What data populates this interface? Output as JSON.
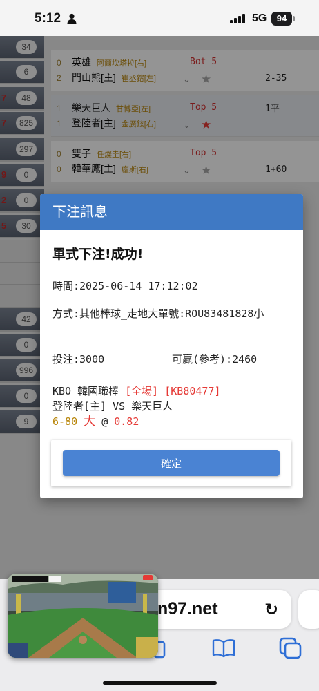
{
  "status_bar": {
    "time": "5:12",
    "network": "5G",
    "battery": "94"
  },
  "left_column": {
    "items": [
      {
        "count": "34",
        "mark": ""
      },
      {
        "count": "6",
        "mark": ""
      },
      {
        "count": "48",
        "mark": "7"
      },
      {
        "count": "825",
        "mark": "7"
      },
      {
        "count": "297",
        "mark": ""
      },
      {
        "count": "0",
        "mark": "9"
      },
      {
        "count": "0",
        "mark": "2"
      },
      {
        "count": "30",
        "mark": "5"
      }
    ],
    "lower_items": [
      {
        "count": "42"
      },
      {
        "count": "0"
      },
      {
        "count": "996"
      },
      {
        "count": "0"
      },
      {
        "count": "9"
      }
    ]
  },
  "games": [
    {
      "away": {
        "score": "0",
        "team": "英雄",
        "pitcher": "阿爾坎塔拉[右]"
      },
      "home": {
        "score": "2",
        "team": "門山熊[主]",
        "pitcher": "崔丞鎔[左]"
      },
      "inning": "Bot 5",
      "line": "2-35",
      "line_row": "home",
      "starred": false
    },
    {
      "away": {
        "score": "1",
        "team": "樂天巨人",
        "pitcher": "甘博亞[左]"
      },
      "home": {
        "score": "1",
        "team": "登陸者[主]",
        "pitcher": "金廣鉉[右]"
      },
      "inning": "Top 5",
      "line": "1平",
      "line_row": "away",
      "starred": true
    },
    {
      "away": {
        "score": "0",
        "team": "雙子",
        "pitcher": "任燦圭[右]"
      },
      "home": {
        "score": "0",
        "team": "韓華鷹[主]",
        "pitcher": "龐斯[右]"
      },
      "inning": "Top 5",
      "line": "1+60",
      "line_row": "home",
      "starred": false
    }
  ],
  "modal": {
    "header": "下注訊息",
    "title": "單式下注!成功!",
    "time_label": "時間:",
    "time_value": "2025-06-14 17:12:02",
    "method_label": "方式:",
    "method_value": "其他棒球_走地大單號:ROU83481828小",
    "stake_label": "投注:",
    "stake_value": "3000",
    "win_label": "可贏(參考):",
    "win_value": "2460",
    "league": "KBO 韓國職棒",
    "period": "[全場]",
    "code": "[KB80477]",
    "matchup": "登陸者[主] VS 樂天巨人",
    "bet_line": "6-80",
    "bet_side": "大",
    "at": "@",
    "odds": "0.82",
    "confirm_label": "確定"
  },
  "safari": {
    "url_fragment": "n97.net"
  },
  "colors": {
    "modal_header": "#3f79c4",
    "confirm_button": "#4a83d3",
    "highlight_red": "#e53935"
  },
  "icons": [
    "person-icon",
    "signal-icon",
    "battery-icon",
    "star-icon",
    "chevron-down-icon",
    "reload-icon",
    "bookmarks-icon",
    "tabs-icon"
  ]
}
